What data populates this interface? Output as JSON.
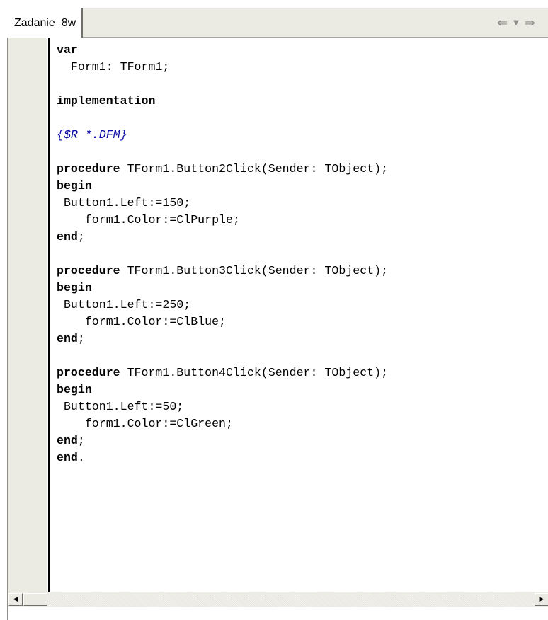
{
  "tab": {
    "label": "Zadanie_8w"
  },
  "nav": {
    "back_icon": "back-arrow-icon",
    "dropdown_icon": "dropdown-arrow-icon",
    "forward_icon": "forward-arrow-icon"
  },
  "code": {
    "lines": [
      {
        "text": "var",
        "style": "kw"
      },
      {
        "text": "  Form1: TForm1;",
        "style": "plain"
      },
      {
        "text": "",
        "style": "plain"
      },
      {
        "text": "implementation",
        "style": "kw"
      },
      {
        "text": "",
        "style": "plain"
      },
      {
        "text": "{$R *.DFM}",
        "style": "cm"
      },
      {
        "text": "",
        "style": "plain"
      },
      {
        "kw": "procedure",
        "rest": " TForm1.Button2Click(Sender: TObject);",
        "style": "mixed"
      },
      {
        "text": "begin",
        "style": "kw"
      },
      {
        "text": " Button1.Left:=150;",
        "style": "plain"
      },
      {
        "text": "    form1.Color:=ClPurple;",
        "style": "plain"
      },
      {
        "kw": "end",
        "rest": ";",
        "style": "mixed"
      },
      {
        "text": "",
        "style": "plain"
      },
      {
        "kw": "procedure",
        "rest": " TForm1.Button3Click(Sender: TObject);",
        "style": "mixed"
      },
      {
        "text": "begin",
        "style": "kw"
      },
      {
        "text": " Button1.Left:=250;",
        "style": "plain"
      },
      {
        "text": "    form1.Color:=ClBlue;",
        "style": "plain"
      },
      {
        "kw": "end",
        "rest": ";",
        "style": "mixed"
      },
      {
        "text": "",
        "style": "plain"
      },
      {
        "kw": "procedure",
        "rest": " TForm1.Button4Click(Sender: TObject);",
        "style": "mixed"
      },
      {
        "text": "begin",
        "style": "kw"
      },
      {
        "text": " Button1.Left:=50;",
        "style": "plain"
      },
      {
        "text": "    form1.Color:=ClGreen;",
        "style": "plain"
      },
      {
        "kw": "end",
        "rest": ";",
        "style": "mixed"
      },
      {
        "kw": "end",
        "rest": ".",
        "style": "mixed"
      }
    ]
  },
  "colors": {
    "comment": "#0a0aa8",
    "gutter": "#ecebe3"
  }
}
